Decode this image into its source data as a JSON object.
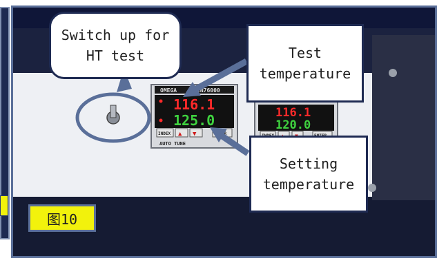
{
  "callouts": {
    "switch_note": "Switch up for\nHT test",
    "test_temp": "Test\ntemperature",
    "setting_temp": "Setting\ntemperature"
  },
  "figure_label": "图10",
  "controller_left": {
    "brand": "OMEGA",
    "model": "CN76000",
    "process_value": "116.1",
    "set_value": "125.0",
    "buttons": [
      "INDEX",
      "▲",
      "▼",
      "ENTER"
    ],
    "footer": "AUTO TUNE"
  },
  "controller_right": {
    "process_value": "116.1",
    "set_value": "120.0",
    "buttons": [
      "INDEX",
      "▲",
      "▼",
      "ENTER"
    ]
  },
  "colors": {
    "frame_border": "#5a6f99",
    "callout_border": "#1e2a52",
    "label_bg": "#f2f20c",
    "led_red": "#ff2a2a",
    "panel_white": "#eef0f4"
  }
}
